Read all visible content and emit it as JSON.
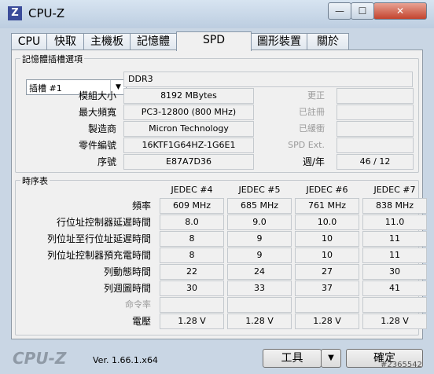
{
  "window": {
    "title": "CPU-Z",
    "icon": "Z",
    "min_symbol": "—",
    "max_symbol": "☐",
    "close_symbol": "✕"
  },
  "tabs": [
    "CPU",
    "快取",
    "主機板",
    "記憶體",
    "SPD",
    "圖形裝置",
    "關於"
  ],
  "active_tab": "SPD",
  "slot": {
    "group_title": "記憶體插槽選項",
    "selected": "插槽 #1",
    "type": "DDR3",
    "module_size_label": "模組大小",
    "module_size": "8192 MBytes",
    "max_bandwidth_label": "最大頻寬",
    "max_bandwidth": "PC3-12800 (800 MHz)",
    "manufacturer_label": "製造商",
    "manufacturer": "Micron Technology",
    "part_number_label": "零件編號",
    "part_number": "16KTF1G64HZ-1G6E1",
    "serial_label": "序號",
    "serial": "E87A7D36",
    "correction_label": "更正",
    "correction": "",
    "registered_label": "已註冊",
    "registered": "",
    "buffered_label": "已緩衝",
    "buffered": "",
    "spd_ext_label": "SPD Ext.",
    "spd_ext": "",
    "week_year_label": "週/年",
    "week_year": "46 / 12"
  },
  "timings": {
    "group_title": "時序表",
    "columns": [
      "JEDEC #4",
      "JEDEC #5",
      "JEDEC #6",
      "JEDEC #7"
    ],
    "rows": [
      {
        "label": "頻率",
        "values": [
          "609 MHz",
          "685 MHz",
          "761 MHz",
          "838 MHz"
        ],
        "dim": false
      },
      {
        "label": "行位址控制器延遲時間",
        "values": [
          "8.0",
          "9.0",
          "10.0",
          "11.0"
        ],
        "dim": false
      },
      {
        "label": "列位址至行位址延遲時間",
        "values": [
          "8",
          "9",
          "10",
          "11"
        ],
        "dim": false
      },
      {
        "label": "列位址控制器預充電時間",
        "values": [
          "8",
          "9",
          "10",
          "11"
        ],
        "dim": false
      },
      {
        "label": "列動態時間",
        "values": [
          "22",
          "24",
          "27",
          "30"
        ],
        "dim": false
      },
      {
        "label": "列週圖時間",
        "values": [
          "30",
          "33",
          "37",
          "41"
        ],
        "dim": false
      },
      {
        "label": "命令率",
        "values": [
          "",
          "",
          "",
          ""
        ],
        "dim": true
      },
      {
        "label": "電壓",
        "values": [
          "1.28 V",
          "1.28 V",
          "1.28 V",
          "1.28 V"
        ],
        "dim": false
      }
    ]
  },
  "footer": {
    "logo": "CPU-Z",
    "version": "Ver. 1.66.1.x64",
    "tools_label": "工具",
    "tools_arrow": "▼",
    "ok_label": "確定",
    "watermark": "#2365542"
  }
}
